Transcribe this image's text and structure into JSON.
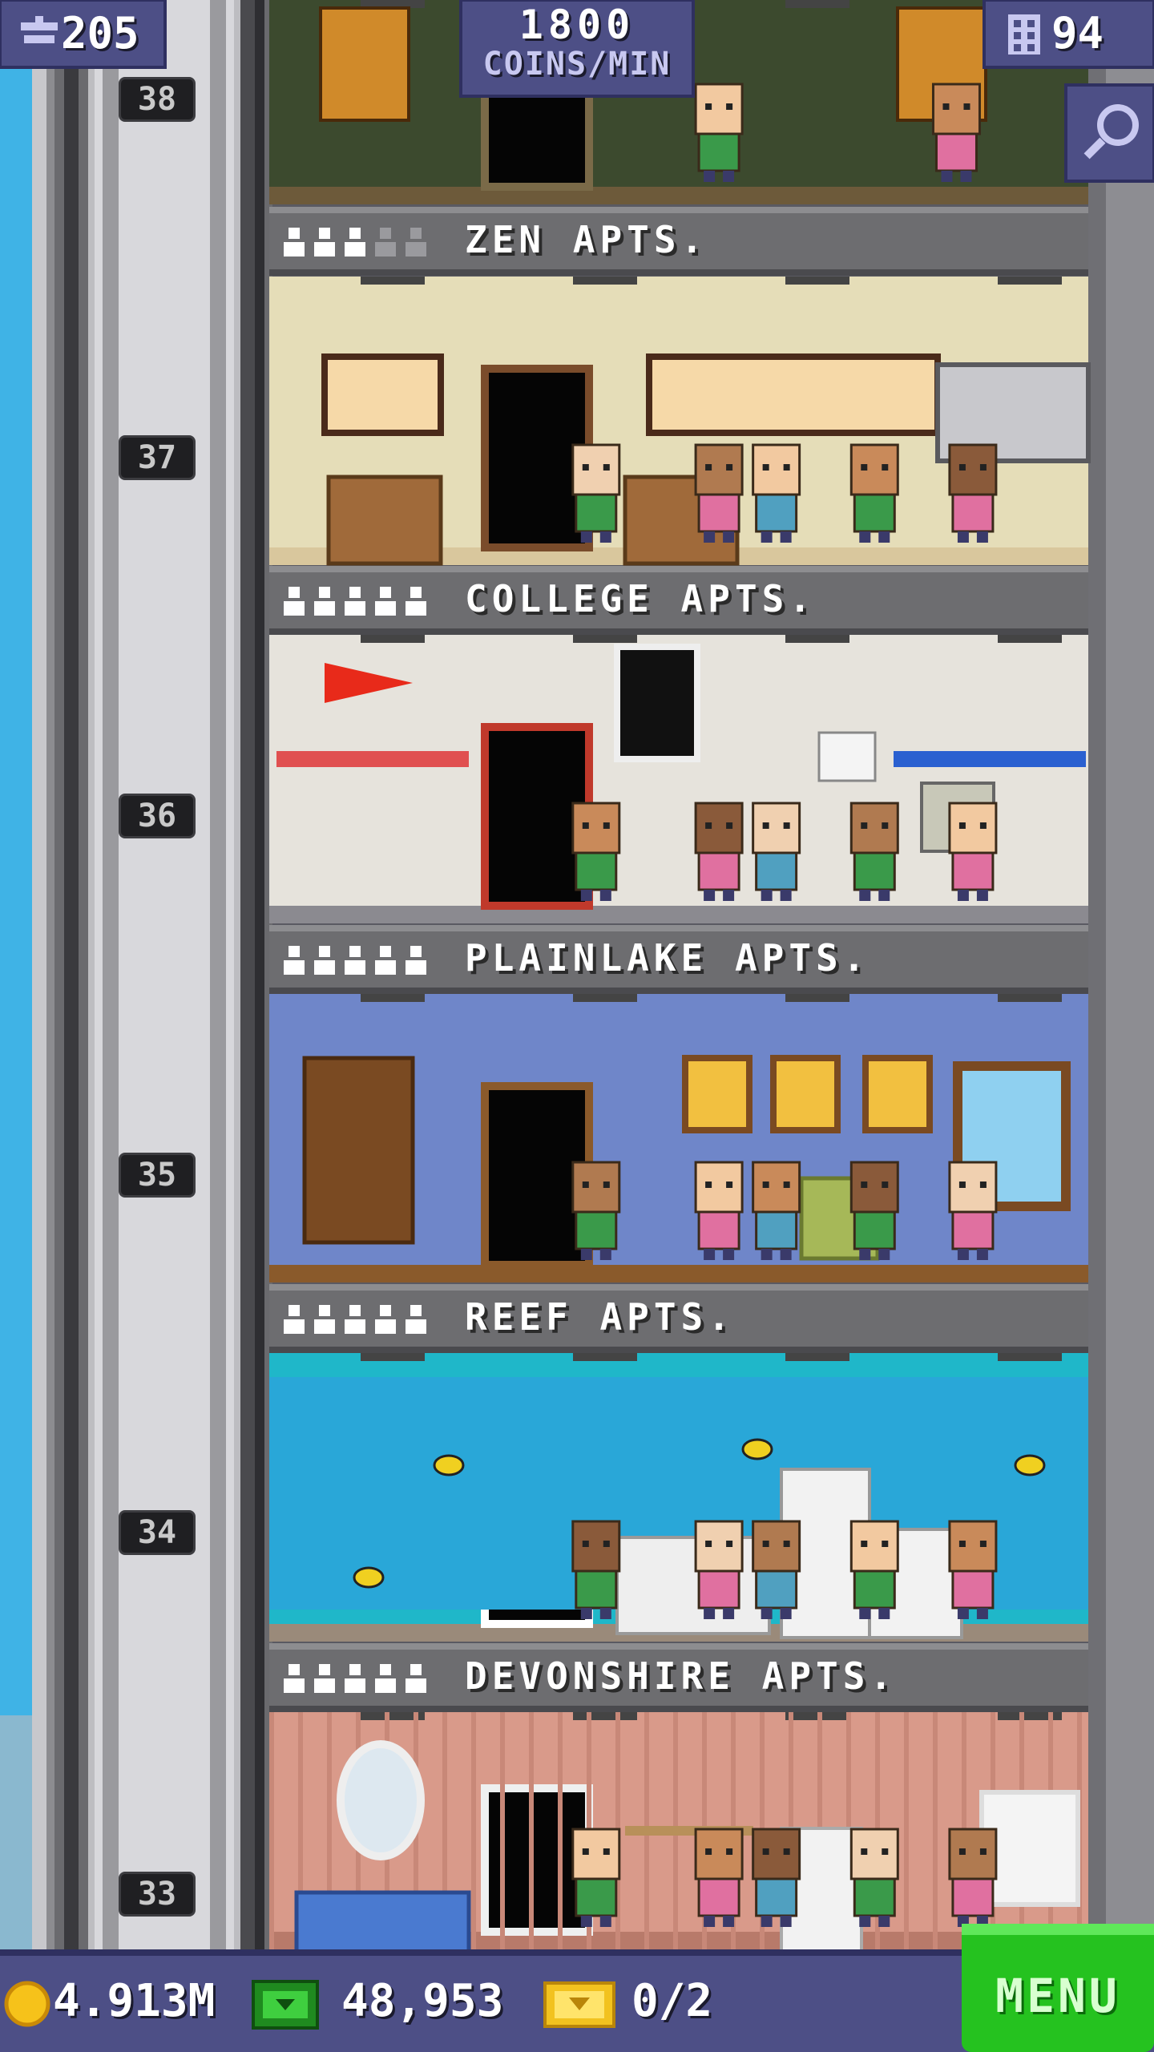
{
  "top_hud": {
    "population": "205",
    "coins_rate_value": "1800",
    "coins_rate_unit": "COINS/MIN",
    "floor_count": "94"
  },
  "floors": [
    {
      "number": "38",
      "name": "ZEN APTS.",
      "filled": 3,
      "capacity": 5,
      "theme": "zen"
    },
    {
      "number": "37",
      "name": "COLLEGE APTS.",
      "filled": 5,
      "capacity": 5,
      "theme": "zen-room"
    },
    {
      "number": "36",
      "name": "PLAINLAKE APTS.",
      "filled": 5,
      "capacity": 5,
      "theme": "college"
    },
    {
      "number": "35",
      "name": "REEF APTS.",
      "filled": 5,
      "capacity": 5,
      "theme": "plainlake"
    },
    {
      "number": "34",
      "name": "DEVONSHIRE APTS.",
      "filled": 5,
      "capacity": 5,
      "theme": "reef"
    },
    {
      "number": "33",
      "name": "",
      "filled": 0,
      "capacity": 0,
      "theme": "devonshire"
    }
  ],
  "bottom_hud": {
    "coins": "4.913M",
    "bux": "48,953",
    "tickets": "0/2",
    "menu_label": "MENU"
  },
  "colors": {
    "hud_bg": "#4d4f86",
    "menu_green": "#25c21f",
    "sky": "#3fb3e6",
    "label_bar": "#6d6d70"
  }
}
